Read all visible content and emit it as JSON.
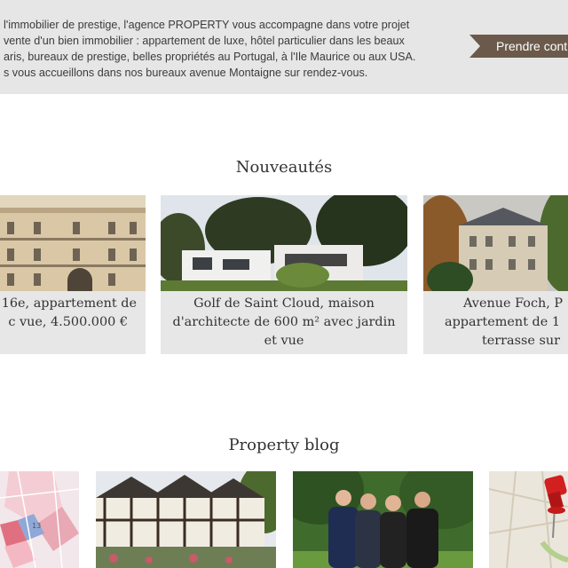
{
  "intro": {
    "lines": [
      "l'immobilier de prestige, l'agence PROPERTY vous accompagne dans votre projet",
      "vente d'un bien immobilier : appartement de luxe, hôtel particulier dans les beaux",
      "aris, bureaux de prestige, belles propriétés au Portugal, à l'Ile Maurice ou aux USA.",
      "s vous accueillons dans nos bureaux avenue Montaigne sur rendez-vous."
    ],
    "cta_label": "Prendre cont"
  },
  "news": {
    "title": "Nouveautés",
    "cards": [
      {
        "lines": [
          "16e, appartement de",
          "c vue, 4.500.000 €"
        ]
      },
      {
        "lines": [
          "Golf de Saint Cloud, maison",
          "d'architecte de 600 m² avec jardin",
          "et vue"
        ]
      },
      {
        "lines": [
          "Avenue Foch, P",
          "appartement de 1",
          "terrasse sur"
        ]
      }
    ]
  },
  "blog": {
    "title": "Property blog",
    "map_label": "13"
  },
  "colors": {
    "banner_bg": "#e6e6e6",
    "cta_bg": "#6b5a4b",
    "caption_bg": "#e7e7e7"
  }
}
